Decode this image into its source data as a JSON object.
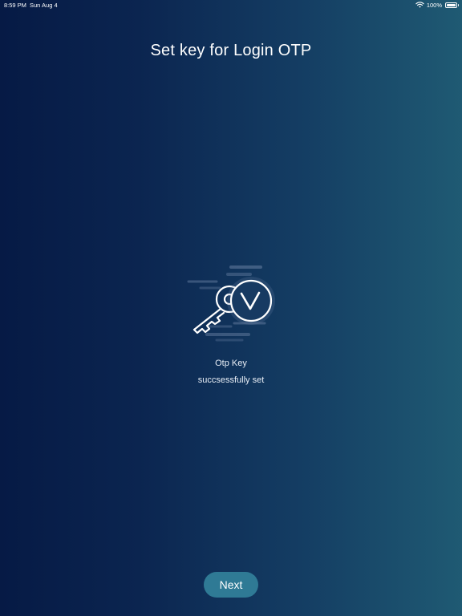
{
  "status_bar": {
    "time": "8:59 PM",
    "date": "Sun Aug 4",
    "battery": "100%",
    "battery_level": 1.0,
    "icons": [
      "wifi-icon",
      "battery-icon"
    ]
  },
  "header": {
    "title": "Set key for Login OTP"
  },
  "illustration": {
    "icon": "key-check-icon"
  },
  "message": {
    "line1": "Otp Key",
    "line2": "succsessfully set"
  },
  "actions": {
    "next_label": "Next"
  },
  "colors": {
    "background_left": "#061a45",
    "background_right": "#1f5a73",
    "button": "#2f7a95",
    "text": "#ffffff"
  }
}
